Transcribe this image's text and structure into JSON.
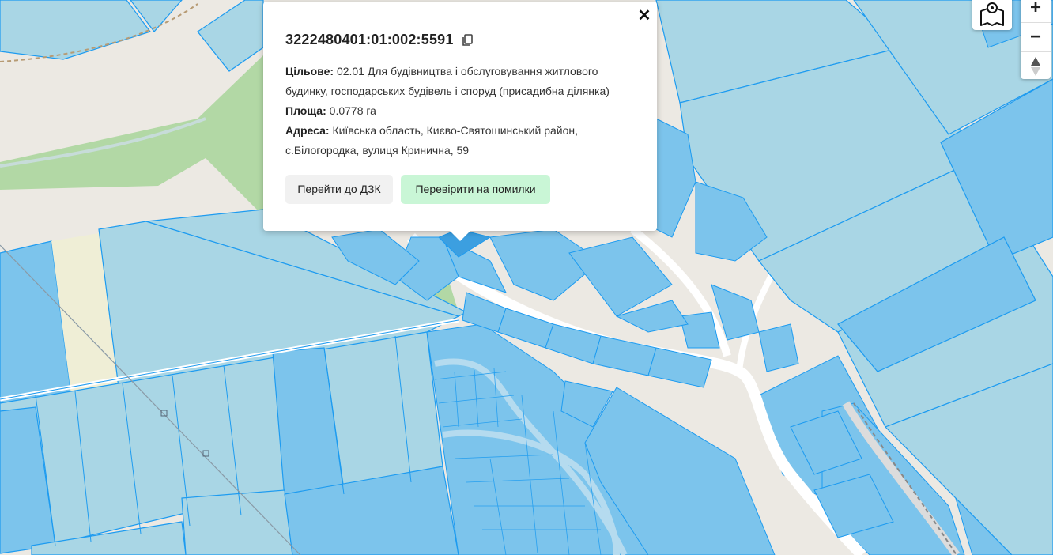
{
  "popup": {
    "cadastral_number": "3222480401:01:002:5591",
    "purpose_label": "Цільове:",
    "purpose_value": "02.01 Для будівництва і обслуговування житлового будинку, господарських будівель і споруд (присадибна ділянка)",
    "area_label": "Площа:",
    "area_value": "0.0778 га",
    "address_label": "Адреса:",
    "address_value": "Київська область, Києво-Святошинський район, с.Білогородка, вулиця Кринична, 59",
    "close_symbol": "✕",
    "button_dzk": "Перейти до ДЗК",
    "button_check": "Перевірити на помилки"
  },
  "controls": {
    "zoom_in": "+",
    "zoom_out": "−",
    "layers_icon": "map-layers-icon",
    "compass_icon": "north-compass-icon"
  },
  "colors": {
    "parcel_fill": "#7cc4ec",
    "parcel_stroke": "#1d9bf0",
    "field_fill": "#a9d6e5",
    "green_area": "#a8d59a",
    "road": "#ffffff",
    "button_check_bg": "#c9f6d6"
  }
}
